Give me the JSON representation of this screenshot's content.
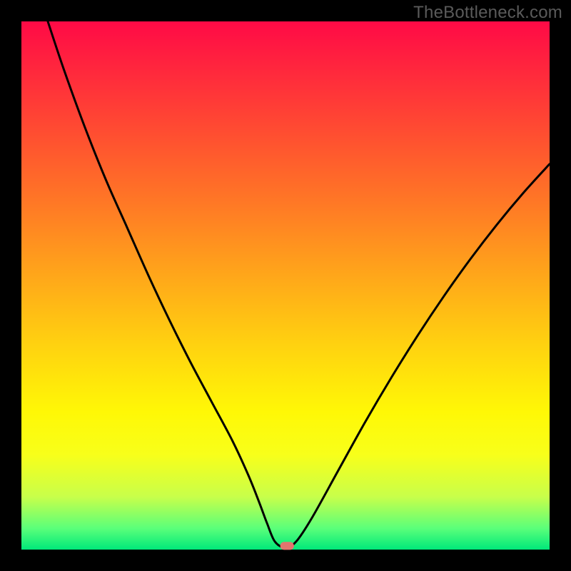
{
  "watermark": "TheBottleneck.com",
  "chart_data": {
    "type": "line",
    "title": "",
    "xlabel": "",
    "ylabel": "",
    "xlim": [
      0,
      100
    ],
    "ylim": [
      0,
      100
    ],
    "grid": false,
    "background_gradient": {
      "orientation": "vertical",
      "stops": [
        {
          "pos": 0.0,
          "color": "#ff0a46"
        },
        {
          "pos": 0.1,
          "color": "#ff2a3c"
        },
        {
          "pos": 0.22,
          "color": "#ff5030"
        },
        {
          "pos": 0.35,
          "color": "#ff7a25"
        },
        {
          "pos": 0.48,
          "color": "#ffa61a"
        },
        {
          "pos": 0.61,
          "color": "#ffd110"
        },
        {
          "pos": 0.74,
          "color": "#fff806"
        },
        {
          "pos": 0.82,
          "color": "#f8ff1a"
        },
        {
          "pos": 0.9,
          "color": "#c8ff4a"
        },
        {
          "pos": 0.96,
          "color": "#5aff7a"
        },
        {
          "pos": 1.0,
          "color": "#00e87a"
        }
      ]
    },
    "series": [
      {
        "name": "bottleneck-curve",
        "color": "#000000",
        "stroke_width": 3,
        "x": [
          5,
          8,
          12,
          16,
          20,
          24,
          28,
          32,
          36,
          40,
          43,
          45,
          46.5,
          48,
          50,
          52,
          55,
          60,
          65,
          70,
          75,
          80,
          85,
          90,
          95,
          100
        ],
        "y": [
          100,
          91,
          80,
          70,
          61,
          52,
          43.5,
          35.5,
          28,
          20.5,
          14,
          9,
          5,
          1.5,
          0.4,
          1.5,
          6,
          15,
          24,
          32.5,
          40.5,
          48,
          55,
          61.5,
          67.5,
          73
        ]
      }
    ],
    "marker": {
      "name": "optimum-point",
      "shape": "pill",
      "x": 50.3,
      "y": 0.7,
      "color": "#e2756e",
      "width_pct": 2.6,
      "height_pct": 1.5
    }
  }
}
